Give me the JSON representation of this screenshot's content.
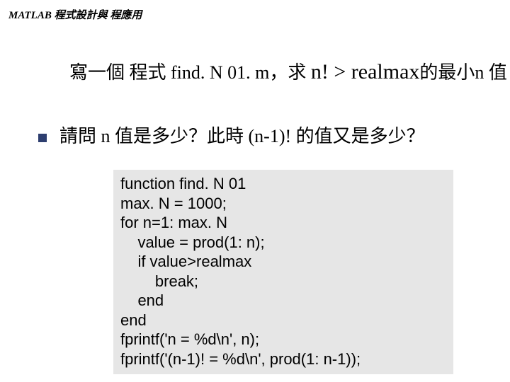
{
  "header": "MATLAB 程式設計與 程應用",
  "line1_parts": {
    "a": "寫一個 程式 find. N 01. m，求 ",
    "b": "n! > realmax",
    "c": "的最小n 值"
  },
  "line2": "請問 n 值是多少？此時 (n-1)! 的值又是多少？",
  "code": [
    "function find. N 01",
    "max. N = 1000;",
    "for n=1: max. N",
    "    value = prod(1: n);",
    "    if value>realmax",
    "        break;",
    "    end",
    "end",
    "fprintf('n = %d\\n', n);",
    "fprintf('(n-1)! = %d\\n', prod(1: n-1));"
  ]
}
